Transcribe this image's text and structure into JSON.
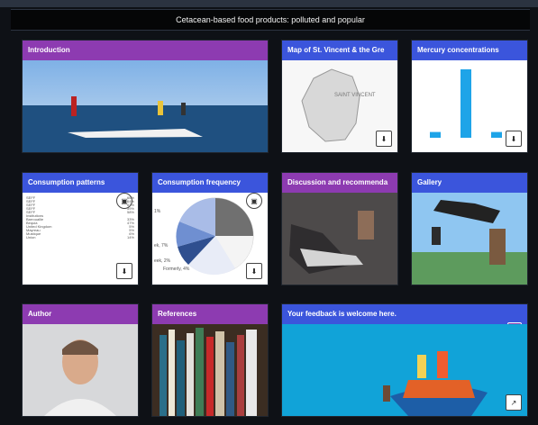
{
  "header": {
    "title": "Cetacean-based food products: polluted and popular"
  },
  "cards": {
    "introduction": {
      "title": "Introduction",
      "icon": "document-icon"
    },
    "map": {
      "title": "Map of St. Vincent & the Gre",
      "map_label": "SAINT VINCENT",
      "icon": "map-icon",
      "download": "download-icon"
    },
    "mercury": {
      "title": "Mercury concentrations",
      "icon": "map-icon",
      "download": "download-icon"
    },
    "consumption_patterns": {
      "title": "Consumption patterns",
      "icon": "map-icon",
      "download": "download-icon",
      "rows": [
        [
          "SEFF",
          "66%"
        ],
        [
          "SEFF",
          "64%"
        ],
        [
          "SEFF",
          "62%"
        ],
        [
          "SEFF",
          "59%"
        ],
        [
          "SEFF",
          "58%"
        ],
        [
          "Institutions",
          ""
        ],
        [
          "Barrouallie",
          "33%"
        ],
        [
          "Bequia",
          "47%"
        ],
        [
          "United Kingdom",
          "5%"
        ],
        [
          "Mayreau",
          "5%"
        ],
        [
          "Mustique",
          "6%"
        ],
        [
          "Union",
          "14%"
        ]
      ]
    },
    "consumption_frequency": {
      "title": "Consumption frequency",
      "icon": "map-icon",
      "download": "download-icon",
      "labels": {
        "a": "1%",
        "b": "ek, 7%",
        "c": "eek, 2%",
        "d": "Formerly, 4%"
      }
    },
    "discussion": {
      "title": "Discussion and recommenda",
      "icon": "document-icon"
    },
    "gallery": {
      "title": "Gallery",
      "icon": "question-icon",
      "icon_text": "?"
    },
    "author": {
      "title": "Author",
      "icon": "document-icon"
    },
    "references": {
      "title": "References",
      "icon": "document-icon"
    },
    "feedback": {
      "title": "Your feedback is welcome here.",
      "icon": "external-link-icon"
    }
  },
  "colors": {
    "purple": "#8d3bb1",
    "blue": "#3b55dc",
    "background": "#0e1116"
  },
  "chart_data": {
    "type": "bar",
    "categories": [
      "",
      "",
      ""
    ],
    "values": [
      8,
      95,
      8
    ],
    "xlabel": "",
    "ylabel": "",
    "title": ""
  }
}
